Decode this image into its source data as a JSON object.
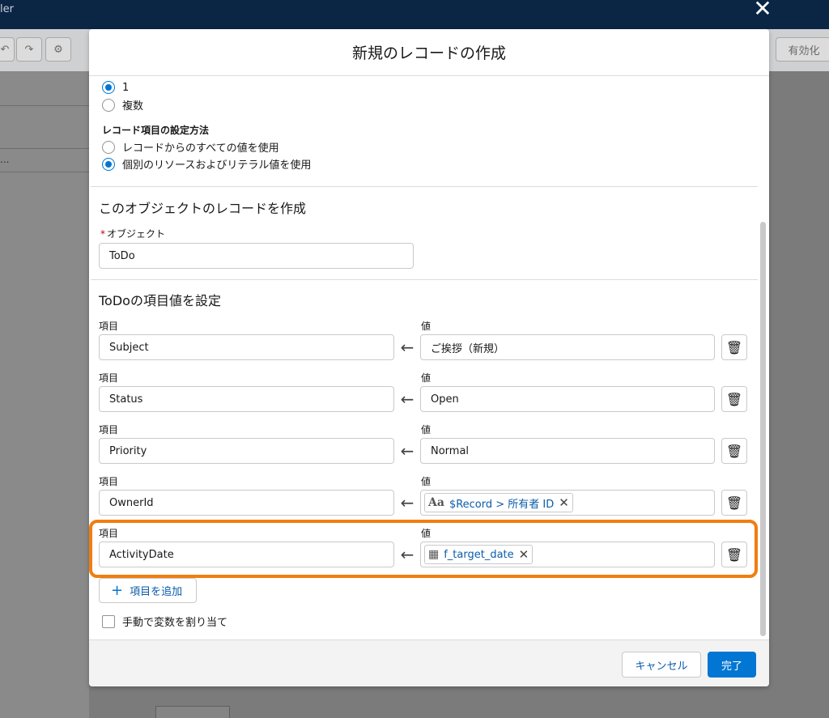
{
  "background": {
    "app_title": "ler",
    "toolbar": {
      "undo_icon": "undo-icon",
      "redo_icon": "redo-icon",
      "settings_icon": "gear-icon",
      "activate_label": "有効化"
    },
    "sidebar_text": "..."
  },
  "modal": {
    "close_icon": "close-icon",
    "title": "新規のレコードの作成",
    "count_options": [
      {
        "label": "1",
        "checked": true
      },
      {
        "label": "複数",
        "checked": false
      }
    ],
    "field_method": {
      "label": "レコード項目の設定方法",
      "options": [
        {
          "label": "レコードからのすべての値を使用",
          "checked": false
        },
        {
          "label": "個別のリソースおよびリテラル値を使用",
          "checked": true
        }
      ]
    },
    "object_section": {
      "title": "このオブジェクトのレコードを作成",
      "object_label": "オブジェクト",
      "required_mark": "*",
      "object_value": "ToDo"
    },
    "field_section": {
      "title": "ToDoの項目値を設定",
      "rows": [
        {
          "field_label": "項目",
          "field": "Subject",
          "value_label": "値",
          "value": "ご挨拶（新規）",
          "type": "text"
        },
        {
          "field_label": "項目",
          "field": "Status",
          "value_label": "値",
          "value": "Open",
          "type": "text"
        },
        {
          "field_label": "項目",
          "field": "Priority",
          "value_label": "値",
          "value": "Normal",
          "type": "text"
        },
        {
          "field_label": "項目",
          "field": "OwnerId",
          "value_label": "値",
          "value": "$Record > 所有者 ID",
          "type": "pill",
          "icon": "text-type-icon"
        },
        {
          "field_label": "項目",
          "field": "ActivityDate",
          "value_label": "値",
          "value": "f_target_date",
          "type": "pill",
          "icon": "calendar-icon"
        }
      ],
      "add_button": "項目を追加",
      "manual_assign": "手動で変数を割り当て"
    },
    "footer": {
      "cancel": "キャンセル",
      "done": "完了"
    },
    "colors": {
      "brand": "#0176d3",
      "highlight": "#f07e0f",
      "link": "#0b5cab"
    }
  }
}
